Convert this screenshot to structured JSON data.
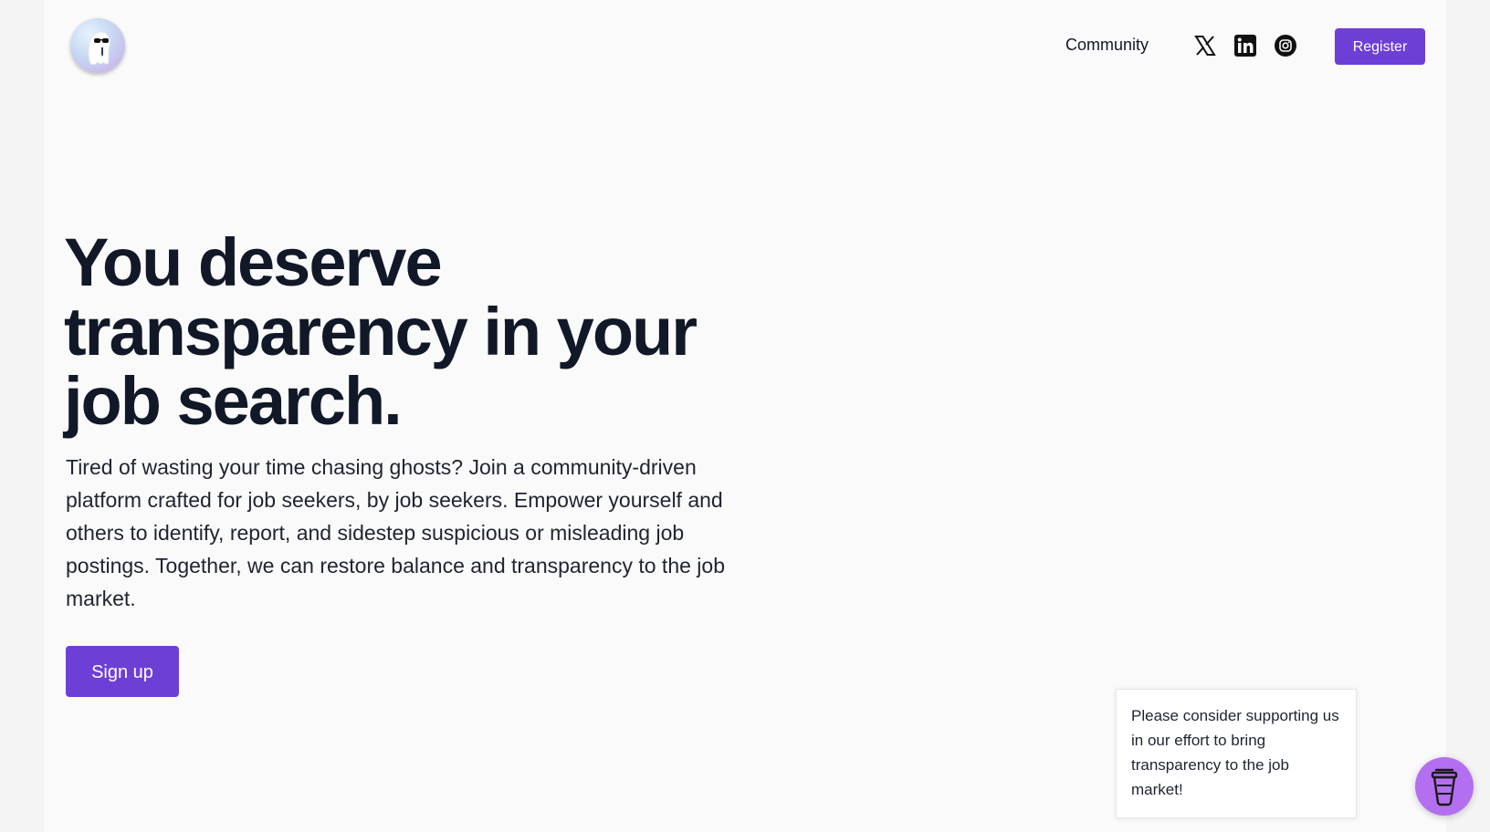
{
  "header": {
    "logo_icon": "ghost-with-sunglasses-logo",
    "nav": {
      "community_label": "Community"
    },
    "social": [
      {
        "icon": "x-icon"
      },
      {
        "icon": "linkedin-icon"
      },
      {
        "icon": "instagram-icon"
      }
    ],
    "register_label": "Register"
  },
  "hero": {
    "headline": "You deserve transparency in your job search.",
    "subtext": "Tired of wasting your time chasing ghosts? Join a community-driven platform crafted for job seekers, by job seekers. Empower yourself and others to identify, report, and sidestep suspicious or misleading job postings. Together, we can restore balance and transparency to the job market.",
    "signup_label": "Sign up"
  },
  "support_widget": {
    "message": "Please consider supporting us in our effort to bring transparency to the job market!",
    "icon": "coffee-cup-icon"
  },
  "colors": {
    "accent": "#6d3fd6",
    "coffee_button": "#b46ff0",
    "background": "#fafafa",
    "text": "#111827"
  }
}
